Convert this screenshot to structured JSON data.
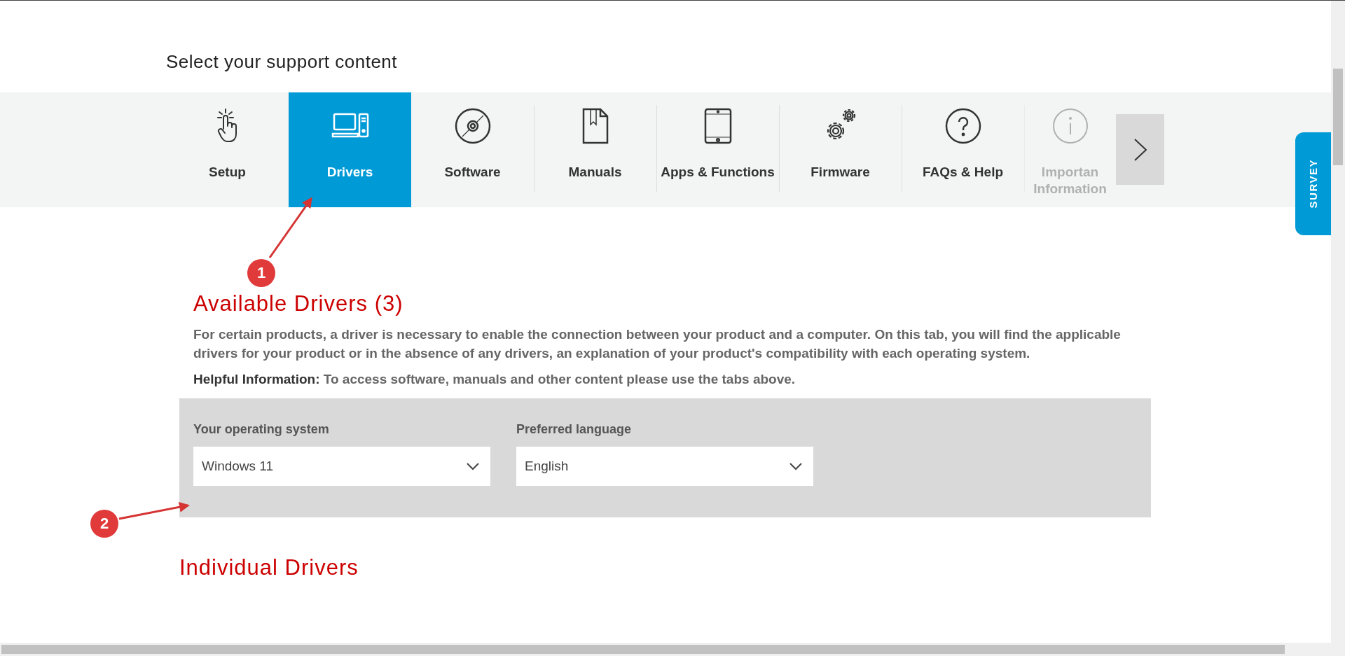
{
  "page": {
    "title": "Select your support content"
  },
  "tabs": [
    {
      "label": "Setup",
      "kind": "touch",
      "selected": false,
      "faded": false
    },
    {
      "label": "Drivers",
      "kind": "computer",
      "selected": true,
      "faded": false
    },
    {
      "label": "Software",
      "kind": "disc",
      "selected": false,
      "faded": false
    },
    {
      "label": "Manuals",
      "kind": "manual",
      "selected": false,
      "faded": false
    },
    {
      "label": "Apps & Functions",
      "kind": "tablet",
      "selected": false,
      "faded": false
    },
    {
      "label": "Firmware",
      "kind": "gears",
      "selected": false,
      "faded": false
    },
    {
      "label": "FAQs & Help",
      "kind": "question",
      "selected": false,
      "faded": false
    },
    {
      "label": "Importan Information",
      "kind": "info",
      "selected": false,
      "faded": true
    }
  ],
  "survey": {
    "label": "SURVEY"
  },
  "drivers": {
    "heading": "Available Drivers (3)",
    "description": "For certain products, a driver is necessary to enable the connection between your product and a computer. On this tab, you will find the applicable drivers for your product or in the absence of any drivers, an explanation of your product's compatibility with each operating system.",
    "helpful": "**Helpful Information:** To access software, manuals and other content please use the tabs above."
  },
  "filters": [
    {
      "label": "Your operating system",
      "value": "Windows 11"
    },
    {
      "label": "Preferred language",
      "value": "English"
    }
  ],
  "individual": {
    "heading": "Individual Drivers"
  },
  "annotations": [
    {
      "number": "1"
    },
    {
      "number": "2"
    }
  ]
}
